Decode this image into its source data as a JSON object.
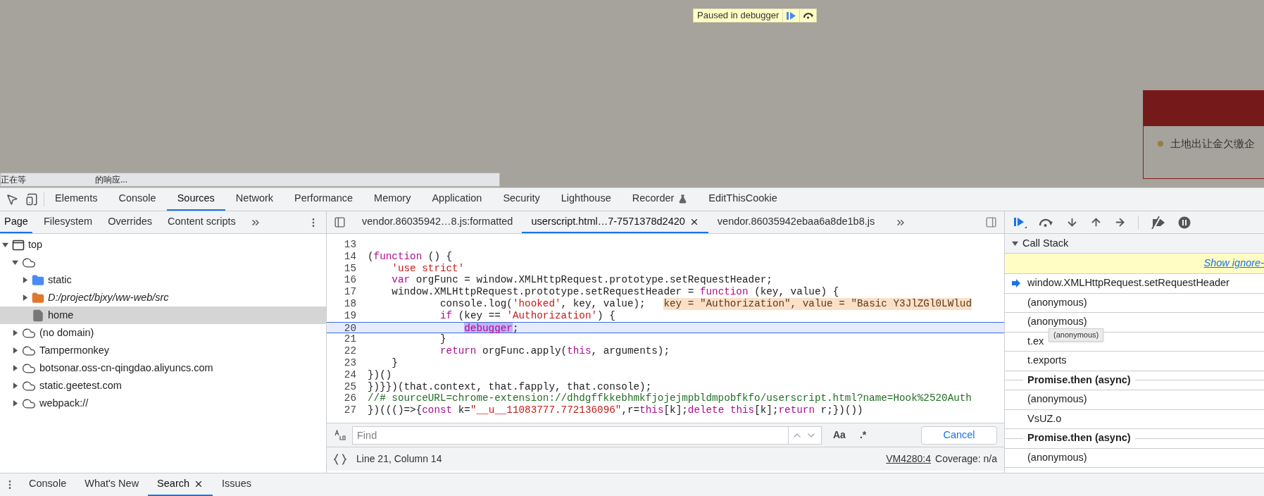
{
  "page": {
    "paused_banner": {
      "label": "Paused in debugger"
    },
    "status_bubble": {
      "before": "正在等",
      "after": "的响应..."
    },
    "notice_panel": {
      "items": [
        "土地出让金欠缴企"
      ]
    }
  },
  "devtools": {
    "tabs": [
      {
        "label": "Elements",
        "selected": false
      },
      {
        "label": "Console",
        "selected": false
      },
      {
        "label": "Sources",
        "selected": true
      },
      {
        "label": "Network",
        "selected": false
      },
      {
        "label": "Performance",
        "selected": false
      },
      {
        "label": "Memory",
        "selected": false
      },
      {
        "label": "Application",
        "selected": false
      },
      {
        "label": "Security",
        "selected": false
      },
      {
        "label": "Lighthouse",
        "selected": false
      },
      {
        "label": "Recorder",
        "selected": false,
        "experimental": true
      },
      {
        "label": "EditThisCookie",
        "selected": false
      }
    ],
    "navigator": {
      "tabs": [
        {
          "label": "Page",
          "selected": true
        },
        {
          "label": "Filesystem",
          "selected": false
        },
        {
          "label": "Overrides",
          "selected": false
        },
        {
          "label": "Content scripts",
          "selected": false
        }
      ],
      "tree": [
        {
          "kind": "frame",
          "label": "top",
          "expanded": true,
          "selected": false,
          "children": [
            {
              "kind": "domain",
              "expanded": true,
              "selected": false,
              "children": [
                {
                  "kind": "folder",
                  "label": "static",
                  "color": "#4a8af4",
                  "italic": false,
                  "expanded": false,
                  "selected": false
                },
                {
                  "kind": "folder",
                  "label": "D:/project/bjxy/ww-web/src",
                  "color": "#e0772b",
                  "italic": true,
                  "expanded": false,
                  "selected": false
                },
                {
                  "kind": "file",
                  "label": "home",
                  "selected": true
                }
              ]
            },
            {
              "kind": "domain",
              "label": "(no domain)",
              "expanded": false,
              "selected": false
            },
            {
              "kind": "domain",
              "label": "Tampermonkey",
              "expanded": false,
              "selected": false
            },
            {
              "kind": "domain",
              "label": "botsonar.oss-cn-qingdao.aliyuncs.com",
              "expanded": false,
              "selected": false
            },
            {
              "kind": "domain",
              "label": "static.geetest.com",
              "expanded": false,
              "selected": false
            },
            {
              "kind": "domain",
              "label": "webpack://",
              "expanded": false,
              "selected": false
            }
          ]
        }
      ]
    },
    "editor": {
      "tabs": [
        {
          "label": "vendor.86035942…8.js:formatted",
          "selected": false
        },
        {
          "label": "userscript.html…7-7571378d2420",
          "selected": true,
          "closable": true
        },
        {
          "label": "vendor.86035942ebaa6a8de1b8.js",
          "selected": false
        }
      ],
      "lines": [
        {
          "number": "13",
          "current": false
        },
        {
          "number": "14",
          "current": false,
          "tokens": [
            {
              "kind": "plain",
              "text": "("
            },
            {
              "kind": "keyword",
              "text": "function"
            },
            {
              "kind": "plain",
              "text": " () {"
            }
          ]
        },
        {
          "number": "15",
          "current": false,
          "tokens": [
            {
              "kind": "string",
              "text": "    'use strict'"
            }
          ]
        },
        {
          "number": "16",
          "current": false,
          "tokens": [
            {
              "kind": "keyword",
              "text": "    var"
            },
            {
              "kind": "plain",
              "text": " orgFunc = window.XMLHttpRequest.prototype.setRequestHeader;"
            }
          ]
        },
        {
          "number": "17",
          "current": false,
          "tokens": [
            {
              "kind": "plain",
              "text": "    window.XMLHttpRequest.prototype.setRequestHeader = "
            },
            {
              "kind": "keyword",
              "text": "function"
            },
            {
              "kind": "plain",
              "text": " (key, value) {"
            }
          ]
        },
        {
          "number": "18",
          "current": false,
          "tokens": [
            {
              "kind": "plain",
              "text": "            console.log("
            },
            {
              "kind": "string",
              "text": "'hooked'"
            },
            {
              "kind": "plain",
              "text": ", key, value);  "
            },
            {
              "kind": "inline_value",
              "text": " key = \"Authorization\", value = \"Basic Y3JlZGl0LWlud"
            }
          ]
        },
        {
          "number": "19",
          "current": false,
          "tokens": [
            {
              "kind": "keyword",
              "text": "            if"
            },
            {
              "kind": "plain",
              "text": " (key == "
            },
            {
              "kind": "string",
              "text": "'Authorization'"
            },
            {
              "kind": "plain",
              "text": ") {"
            }
          ]
        },
        {
          "number": "20",
          "current": true,
          "tokens": [
            {
              "kind": "paused",
              "text": "                debugger"
            },
            {
              "kind": "plain",
              "text": ";"
            }
          ]
        },
        {
          "number": "21",
          "current": false,
          "tokens": [
            {
              "kind": "plain",
              "text": "            }"
            }
          ]
        },
        {
          "number": "22",
          "current": false,
          "tokens": [
            {
              "kind": "keyword",
              "text": "            return"
            },
            {
              "kind": "plain",
              "text": " orgFunc.apply("
            },
            {
              "kind": "keyword",
              "text": "this"
            },
            {
              "kind": "plain",
              "text": ", arguments);"
            }
          ]
        },
        {
          "number": "23",
          "current": false,
          "tokens": [
            {
              "kind": "plain",
              "text": "    }"
            }
          ]
        },
        {
          "number": "24",
          "current": false,
          "tokens": [
            {
              "kind": "plain",
              "text": "})()"
            }
          ]
        },
        {
          "number": "25",
          "current": false,
          "tokens": [
            {
              "kind": "plain",
              "text": "})}})(that.context, that.fapply, that.console);"
            }
          ]
        },
        {
          "number": "26",
          "current": false,
          "tokens": [
            {
              "kind": "comment",
              "text": "//# sourceURL=chrome-extension://dhdgffkkebhmkfjojejmpbldmpobfkfo/userscript.html?name=Hook%2520Auth"
            }
          ]
        },
        {
          "number": "27",
          "current": false,
          "tokens": [
            {
              "kind": "plain",
              "text": "})((()=>{"
            },
            {
              "kind": "keyword",
              "text": "const"
            },
            {
              "kind": "plain",
              "text": " k="
            },
            {
              "kind": "string",
              "text": "\"__u__11083777.772136096\""
            },
            {
              "kind": "plain",
              "text": ",r="
            },
            {
              "kind": "keyword",
              "text": "this"
            },
            {
              "kind": "plain",
              "text": "[k];"
            },
            {
              "kind": "keyword",
              "text": "delete"
            },
            {
              "kind": "keyword",
              "text": " this"
            },
            {
              "kind": "plain",
              "text": "[k];"
            },
            {
              "kind": "keyword",
              "text": "return"
            },
            {
              "kind": "plain",
              "text": " r;})())"
            }
          ]
        }
      ],
      "find": {
        "placeholder": "Find",
        "case_toggle": "Aa",
        "regex_toggle": ".*",
        "cancel": "Cancel"
      },
      "status": {
        "position": "Line 21, Column 14",
        "location": "VM4280:4",
        "coverage": "Coverage: n/a"
      }
    },
    "debugger": {
      "call_stack": {
        "title": "Call Stack",
        "expanded": true,
        "notice_link": "Show ignore-",
        "frames": [
          {
            "kind": "frame",
            "label": "window.XMLHttpRequest.setRequestHeader",
            "selected": true
          },
          {
            "kind": "frame",
            "label": "(anonymous)",
            "selected": false
          },
          {
            "kind": "frame",
            "label": "(anonymous)",
            "selected": false,
            "tooltip": "(anonymous)"
          },
          {
            "kind": "frame",
            "label": "t.ex",
            "selected": false
          },
          {
            "kind": "frame",
            "label": "t.exports",
            "selected": false
          },
          {
            "kind": "async",
            "label": "Promise.then (async)"
          },
          {
            "kind": "frame",
            "label": "(anonymous)",
            "selected": false
          },
          {
            "kind": "frame",
            "label": "VsUZ.o",
            "selected": false
          },
          {
            "kind": "async",
            "label": "Promise.then (async)"
          },
          {
            "kind": "frame",
            "label": "(anonymous)",
            "selected": false
          }
        ]
      }
    },
    "drawer": {
      "tabs": [
        {
          "label": "Console",
          "selected": false
        },
        {
          "label": "What's New",
          "selected": false
        },
        {
          "label": "Search",
          "selected": true,
          "closable": true
        },
        {
          "label": "Issues",
          "selected": false
        }
      ]
    }
  }
}
